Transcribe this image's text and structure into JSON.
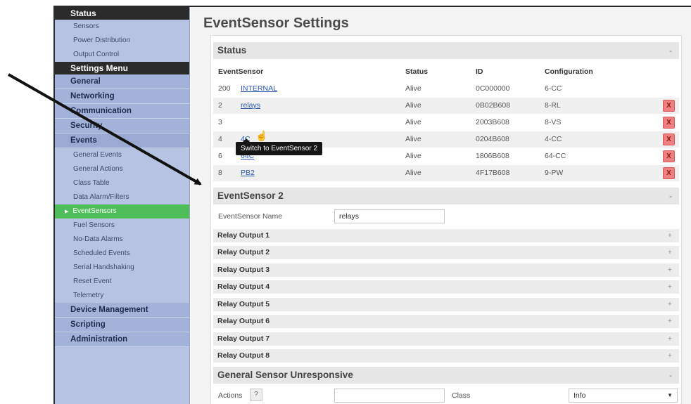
{
  "sidebar": {
    "status_head": "Status",
    "status_items": [
      "Sensors",
      "Power Distribution",
      "Output Control"
    ],
    "settings_head": "Settings Menu",
    "categories_top": [
      "General",
      "Networking",
      "Communication",
      "Security",
      "Events"
    ],
    "event_items": [
      "General Events",
      "General Actions",
      "Class Table",
      "Data Alarm/Filters"
    ],
    "active_item": "EventSensors",
    "event_items_after": [
      "Fuel Sensors",
      "No-Data Alarms",
      "Scheduled Events",
      "Serial Handshaking",
      "Reset Event",
      "Telemetry"
    ],
    "categories_bottom": [
      "Device Management",
      "Scripting",
      "Administration"
    ]
  },
  "page_title": "EventSensor Settings",
  "status_section": {
    "title": "Status",
    "toggle": "-",
    "headers": [
      "EventSensor",
      "Status",
      "ID",
      "Configuration"
    ],
    "rows": [
      {
        "num": "200",
        "name": "INTERNAL",
        "status": "Alive",
        "id": "0C000000",
        "config": "6-CC",
        "delete": ""
      },
      {
        "num": "2",
        "name": "relays",
        "status": "Alive",
        "id": "0B02B608",
        "config": "8-RL",
        "delete": "X"
      },
      {
        "num": "3",
        "name": "",
        "status": "Alive",
        "id": "2003B608",
        "config": "8-VS",
        "delete": "X"
      },
      {
        "num": "4",
        "name": "4C",
        "status": "Alive",
        "id": "0204B608",
        "config": "4-CC",
        "delete": "X"
      },
      {
        "num": "6",
        "name": "64C",
        "status": "Alive",
        "id": "1806B608",
        "config": "64-CC",
        "delete": "X"
      },
      {
        "num": "8",
        "name": "PB2",
        "status": "Alive",
        "id": "4F17B608",
        "config": "9-PW",
        "delete": "X"
      }
    ],
    "tooltip": "Switch to EventSensor 2"
  },
  "eventsensor_section": {
    "title": "EventSensor 2",
    "toggle": "-",
    "name_label": "EventSensor Name",
    "name_value": "relays",
    "relays": [
      "Relay Output 1",
      "Relay Output 2",
      "Relay Output 3",
      "Relay Output 4",
      "Relay Output 5",
      "Relay Output 6",
      "Relay Output 7",
      "Relay Output 8"
    ],
    "expand": "+"
  },
  "unresponsive_section": {
    "title": "General Sensor Unresponsive",
    "toggle": "-",
    "actions_label": "Actions",
    "help": "?",
    "actions_value": "",
    "class_label": "Class",
    "class_value": "Info"
  },
  "colors": {
    "active_green": "#4fbe5a",
    "delete_red": "#f08080",
    "link_blue": "#2a58b0"
  }
}
